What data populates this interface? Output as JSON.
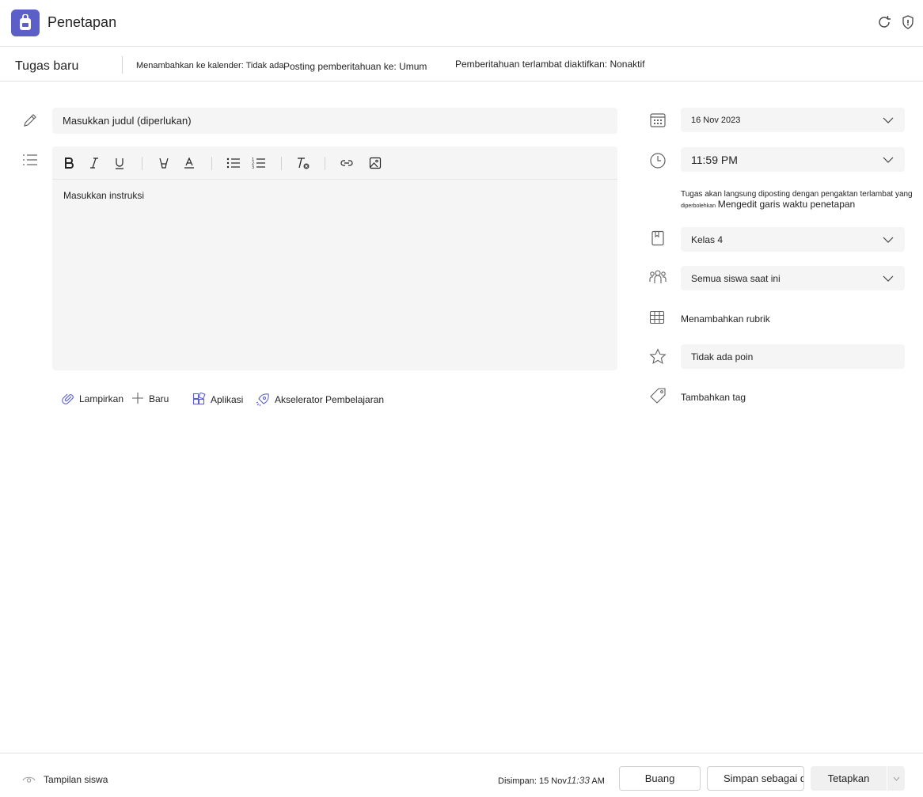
{
  "app": {
    "title": "Penetapan",
    "accent_color": "#5b5fc7"
  },
  "subheader": {
    "title": "Tugas baru",
    "calendar_setting": "Menambahkan ke kalender: Tidak ada",
    "notification_setting": "Posting pemberitahuan ke: Umum",
    "late_setting": "Pemberitahuan terlambat diaktifkan: Nonaktif"
  },
  "form": {
    "title_placeholder": "Masukkan judul (diperlukan)",
    "instructions_placeholder": "Masukkan instruksi"
  },
  "toolbar": {
    "icons": [
      "bold-icon",
      "italic-icon",
      "underline-icon",
      "highlight-icon",
      "font-color-icon",
      "bullet-list-icon",
      "numbered-list-icon",
      "clear-format-icon",
      "link-icon",
      "image-icon"
    ]
  },
  "attachments": {
    "attach": "Lampirkan",
    "new": "Baru",
    "apps": "Aplikasi",
    "accelerators": "Akselerator Pembelajaran"
  },
  "side": {
    "due_date": "16 Nov 2023",
    "due_time": "11:59 PM",
    "due_note_main": "Tugas akan langsung diposting dengan pengaktan terlambat yang",
    "due_note_small": "diperbolehkan",
    "edit_timeline": "Mengedit garis waktu penetapan",
    "class": "Kelas 4",
    "students": "Semua siswa saat ini",
    "rubric": "Menambahkan rubrik",
    "points": "Tidak ada poin",
    "tag": "Tambahkan tag"
  },
  "footer": {
    "student_view": "Tampilan siswa",
    "saved_label": "Disimpan: 15 Nov",
    "saved_time": "11:33",
    "saved_ampm": " AM",
    "discard": "Buang",
    "save_draft": "Simpan sebagai draf",
    "assign": "Tetapkan"
  }
}
